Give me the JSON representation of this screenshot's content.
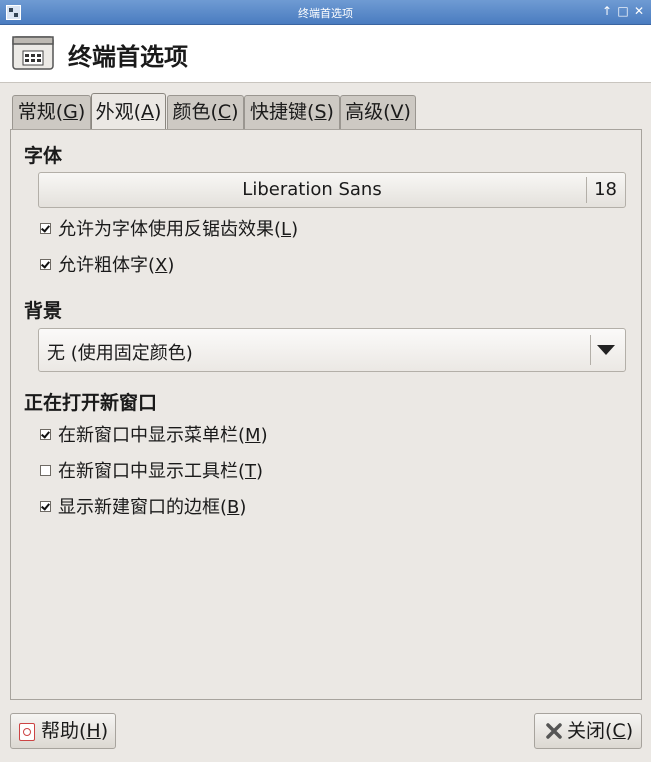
{
  "window": {
    "title": "终端首选项",
    "controls": {
      "up": "↑",
      "maximize": "□",
      "close": "✕"
    }
  },
  "header": {
    "title": "终端首选项",
    "icon": "terminal-preferences-icon"
  },
  "tabs": [
    {
      "label": "常规(",
      "mnemonic": "G",
      "close": ")",
      "active": false
    },
    {
      "label": "外观(",
      "mnemonic": "A",
      "close": ")",
      "active": true
    },
    {
      "label": "颜色(",
      "mnemonic": "C",
      "close": ")",
      "active": false
    },
    {
      "label": "快捷键(",
      "mnemonic": "S",
      "close": ")",
      "active": false
    },
    {
      "label": "高级(",
      "mnemonic": "V",
      "close": ")",
      "active": false
    }
  ],
  "font_section": {
    "heading": "字体",
    "font_name": "Liberation Sans",
    "font_size": "18",
    "antialias": {
      "label": "允许为字体使用反锯齿效果(",
      "mnemonic": "L",
      "close": ")",
      "checked": true
    },
    "bold": {
      "label": "允许粗体字(",
      "mnemonic": "X",
      "close": ")",
      "checked": true
    }
  },
  "background_section": {
    "heading": "背景",
    "selected": "无 (使用固定颜色)"
  },
  "new_window_section": {
    "heading": "正在打开新窗口",
    "menubar": {
      "label": "在新窗口中显示菜单栏(",
      "mnemonic": "M",
      "close": ")",
      "checked": true
    },
    "toolbar": {
      "label": "在新窗口中显示工具栏(",
      "mnemonic": "T",
      "close": ")",
      "checked": false
    },
    "borders": {
      "label": "显示新建窗口的边框(",
      "mnemonic": "B",
      "close": ")",
      "checked": true
    }
  },
  "buttons": {
    "help": {
      "label": "帮助(",
      "mnemonic": "H",
      "close": ")"
    },
    "close": {
      "label": "关闭(",
      "mnemonic": "C",
      "close": ")"
    }
  },
  "colors": {
    "titlebar": "#4a7cc0",
    "background": "#ebe8e4",
    "header": "#ffffff"
  }
}
